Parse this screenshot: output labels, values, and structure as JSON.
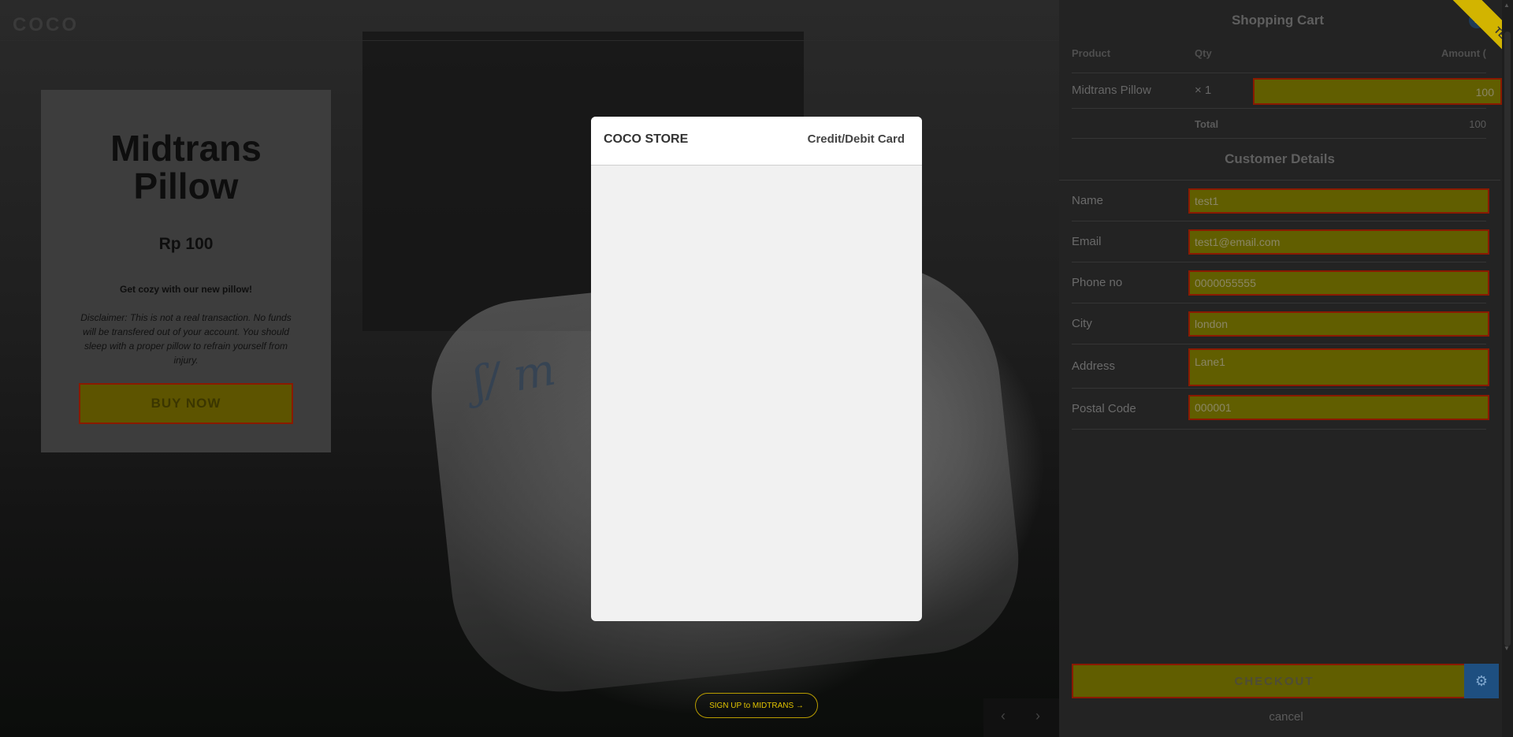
{
  "store": {
    "logo": "COCO",
    "product": {
      "title_line1": "Midtrans",
      "title_line2": "Pillow",
      "price": "Rp 100",
      "tagline": "Get cozy with our new pillow!",
      "disclaimer": "Disclaimer: This is not a real transaction. No funds will be transfered out of your account. You should sleep with a proper pillow to refrain yourself from injury.",
      "buy_label": "BUY NOW"
    },
    "signup_label": "SIGN UP to MIDTRANS →",
    "slider_prev": "‹",
    "slider_next": "›"
  },
  "cart": {
    "title": "Shopping Cart",
    "badge_count": "1",
    "ribbon": "TEST",
    "headers": {
      "product": "Product",
      "qty": "Qty",
      "amount": "Amount ("
    },
    "items": [
      {
        "name": "Midtrans Pillow",
        "qty": "× 1",
        "amount": "100"
      }
    ],
    "total_label": "Total",
    "total_value": "100"
  },
  "customer": {
    "title": "Customer Details",
    "fields": [
      {
        "label": "Name",
        "value": "test1"
      },
      {
        "label": "Email",
        "value": "test1@email.com"
      },
      {
        "label": "Phone no",
        "value": "0000055555"
      },
      {
        "label": "City",
        "value": "london"
      },
      {
        "label": "Address",
        "value": "Lane1"
      },
      {
        "label": "Postal Code",
        "value": "000001"
      }
    ],
    "checkout_label": "CHECKOUT",
    "settings_icon": "gear-icon",
    "cancel_label": "cancel"
  },
  "modal": {
    "merchant": "COCO STORE",
    "payment_method": "Credit/Debit Card"
  },
  "colors": {
    "accent_yellow": "#d2b400",
    "field_fill": "#615e00",
    "field_border": "#8a1a00",
    "badge_blue": "#1d3a58"
  }
}
